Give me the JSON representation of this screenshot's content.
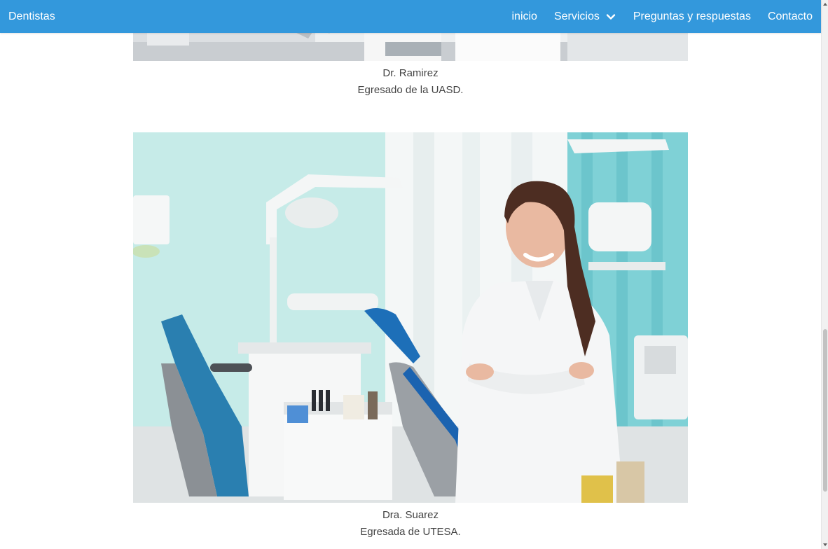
{
  "navbar": {
    "brand": "Dentistas",
    "links": [
      {
        "label": "inicio"
      },
      {
        "label": "Servicios",
        "has_dropdown": true
      },
      {
        "label": "Preguntas y respuestas"
      },
      {
        "label": "Contacto"
      }
    ],
    "background_color": "#3398dc",
    "icons": {
      "dropdown": "chevron-down-icon"
    }
  },
  "doctors": [
    {
      "name": "Dr. Ramirez",
      "description": "Egresado de la UASD."
    },
    {
      "name": "Dra. Suarez",
      "description": "Egresada de UTESA."
    }
  ]
}
